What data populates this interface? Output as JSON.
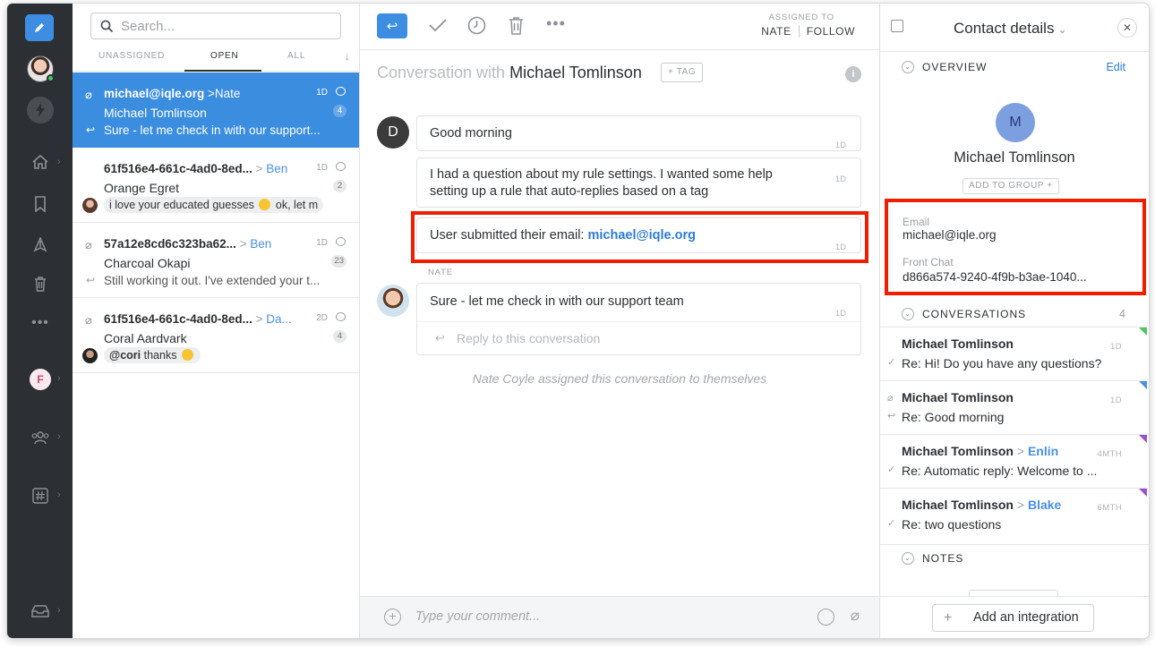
{
  "rail": {
    "items": [
      "compose-icon",
      "avatar",
      "bolt-icon",
      "home-icon",
      "bookmark-icon",
      "spam-icon",
      "trash-icon",
      "more-icon",
      "f-inbox",
      "team-icon",
      "hashtag-icon",
      "inbox-tray-icon"
    ],
    "f_initial": "F"
  },
  "list": {
    "search_placeholder": "Search...",
    "tabs": [
      "UNASSIGNED",
      "OPEN",
      "ALL"
    ],
    "active_tab": "OPEN",
    "conversations": [
      {
        "subject": "michael@iqle.org",
        "to": "Nate",
        "name": "Michael Tomlinson",
        "preview": "Sure - let me check in with our support...",
        "time": "1D",
        "count": "4"
      },
      {
        "subject": "61f516e4-661c-4ad0-8ed...",
        "to": "Ben",
        "name": "Orange Egret",
        "preview_a": "i love your educated guesses",
        "preview_b": "ok, let m",
        "time": "1D",
        "count": "2"
      },
      {
        "subject": "57a12e8cd6c323ba62...",
        "to": "Ben",
        "name": "Charcoal Okapi",
        "preview": "Still working it out. I've extended your t...",
        "time": "1D",
        "count": "23"
      },
      {
        "subject": "61f516e4-661c-4ad0-8ed...",
        "to": "Da...",
        "name": "Coral Aardvark",
        "preview_a": "@cori",
        "preview_b": "thanks",
        "time": "2D",
        "count": "4"
      }
    ]
  },
  "center": {
    "assigned_to_label": "ASSIGNED TO",
    "assignee": "NATE",
    "follow": "FOLLOW",
    "title_prefix": "Conversation with",
    "title_name": "Michael Tomlinson",
    "tag_label": "TAG",
    "avatar_initial": "D",
    "messages": [
      {
        "text": "Good morning",
        "time": "1D"
      },
      {
        "text": "I had a question about my rule settings. I wanted some help setting up a rule that auto-replies based on a tag",
        "time": "1D"
      },
      {
        "text_prefix": "User submitted their email:",
        "email": "michael@iqle.org",
        "time": "1D"
      }
    ],
    "nate_label": "NATE",
    "reply": {
      "text": "Sure - let me check in with our support team",
      "time": "1D"
    },
    "reply_placeholder": "Reply to this conversation",
    "system_note": "Nate Coyle assigned this conversation to themselves",
    "comment_placeholder": "Type your comment..."
  },
  "right": {
    "title": "Contact details",
    "overview_label": "OVERVIEW",
    "edit": "Edit",
    "avatar_initial": "M",
    "contact_name": "Michael Tomlinson",
    "add_to_group": "ADD TO GROUP",
    "email_label": "Email",
    "email_value": "michael@iqle.org",
    "front_chat_label": "Front Chat",
    "front_chat_value": "d866a574-9240-4f9b-b3ae-1040...",
    "conversations_label": "CONVERSATIONS",
    "conversations_count": "4",
    "conversations": [
      {
        "name": "Michael Tomlinson",
        "to": "",
        "subject": "Re: Hi! Do you have any questions?",
        "time": "1D",
        "status": "✓",
        "corner": "#4cc761"
      },
      {
        "name": "Michael Tomlinson",
        "to": "",
        "subject": "Re: Good morning",
        "time": "1D",
        "status": "↩",
        "corner": "#4a90e2"
      },
      {
        "name": "Michael Tomlinson",
        "to": "Enlin",
        "subject": "Re: Automatic reply: Welcome to ...",
        "time": "4MTH",
        "status": "✓",
        "corner": "#9b4fd1"
      },
      {
        "name": "Michael Tomlinson",
        "to": "Blake",
        "subject": "Re: two questions",
        "time": "6MTH",
        "status": "✓",
        "corner": "#9b4fd1"
      }
    ],
    "notes_label": "NOTES",
    "add_integration": "Add an integration"
  },
  "colors": {
    "accent": "#3d8ee3",
    "highlight": "#ef1e00",
    "rail": "#2c2f33"
  }
}
